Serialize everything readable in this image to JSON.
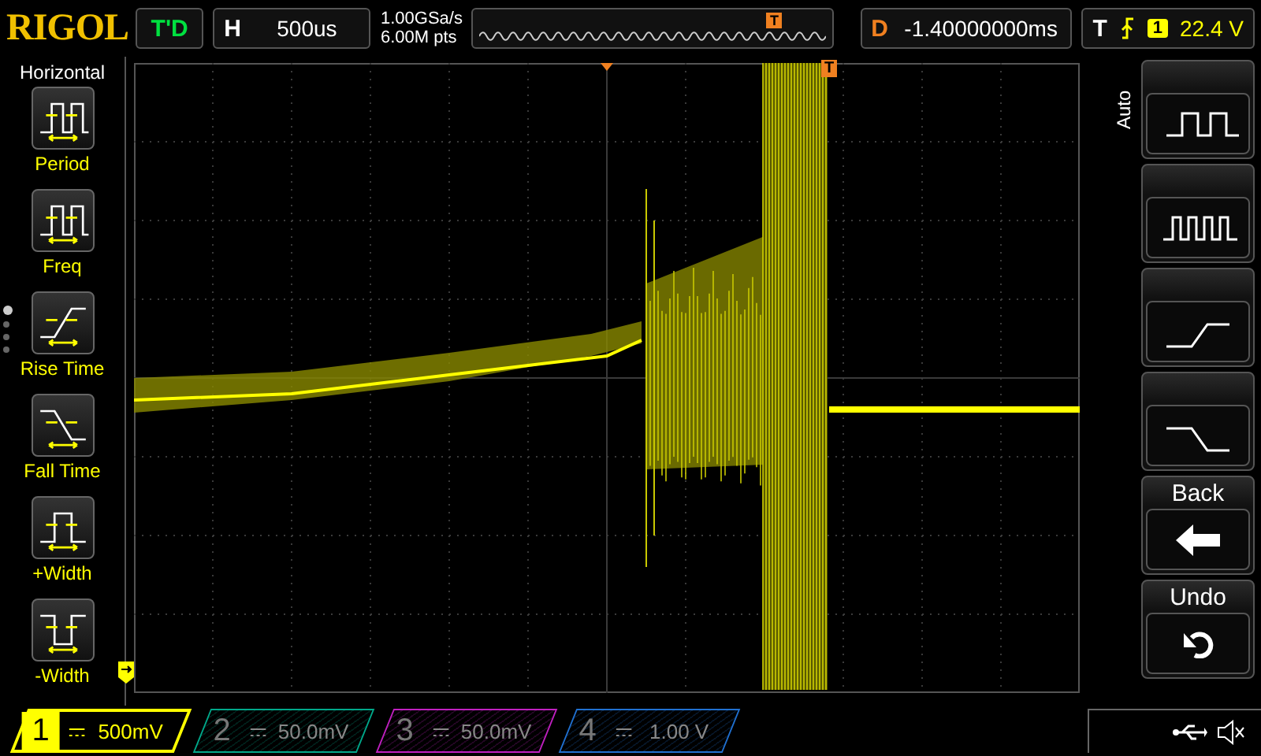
{
  "brand": "RIGOL",
  "run_status": "T'D",
  "horizontal": {
    "label": "H",
    "value": "500us"
  },
  "sample_rate": "1.00GSa/s",
  "memory_depth": "6.00M pts",
  "memory_trigger_marker": "T",
  "delay": {
    "label": "D",
    "value": "-1.40000000ms"
  },
  "trigger": {
    "label": "T",
    "source": "1",
    "level": "22.4 V"
  },
  "left_menu": {
    "title": "Horizontal",
    "items": [
      {
        "label": "Period",
        "kind": "period"
      },
      {
        "label": "Freq",
        "kind": "freq"
      },
      {
        "label": "Rise Time",
        "kind": "rise"
      },
      {
        "label": "Fall Time",
        "kind": "fall"
      },
      {
        "label": "+Width",
        "kind": "pwidth"
      },
      {
        "label": "-Width",
        "kind": "nwidth"
      }
    ],
    "pages": [
      {
        "selected": true
      },
      {
        "selected": false
      },
      {
        "selected": false
      },
      {
        "selected": false
      }
    ]
  },
  "screen": {
    "trigger_position_marker": "T"
  },
  "right_menu": {
    "title": "Auto",
    "items": [
      {
        "kind": "square_slow"
      },
      {
        "kind": "square_fast"
      },
      {
        "kind": "rise"
      },
      {
        "kind": "fall"
      },
      {
        "label": "Back",
        "kind": "back"
      },
      {
        "label": "Undo",
        "kind": "undo"
      }
    ]
  },
  "channels": [
    {
      "number": "1",
      "scale": "500mV",
      "on": true,
      "color": "#ffff00"
    },
    {
      "number": "2",
      "scale": "50.0mV",
      "on": false,
      "color": "#00a88a"
    },
    {
      "number": "3",
      "scale": "50.0mV",
      "on": false,
      "color": "#c020c0"
    },
    {
      "number": "4",
      "scale": "1.00 V",
      "on": false,
      "color": "#2070d0"
    }
  ]
}
